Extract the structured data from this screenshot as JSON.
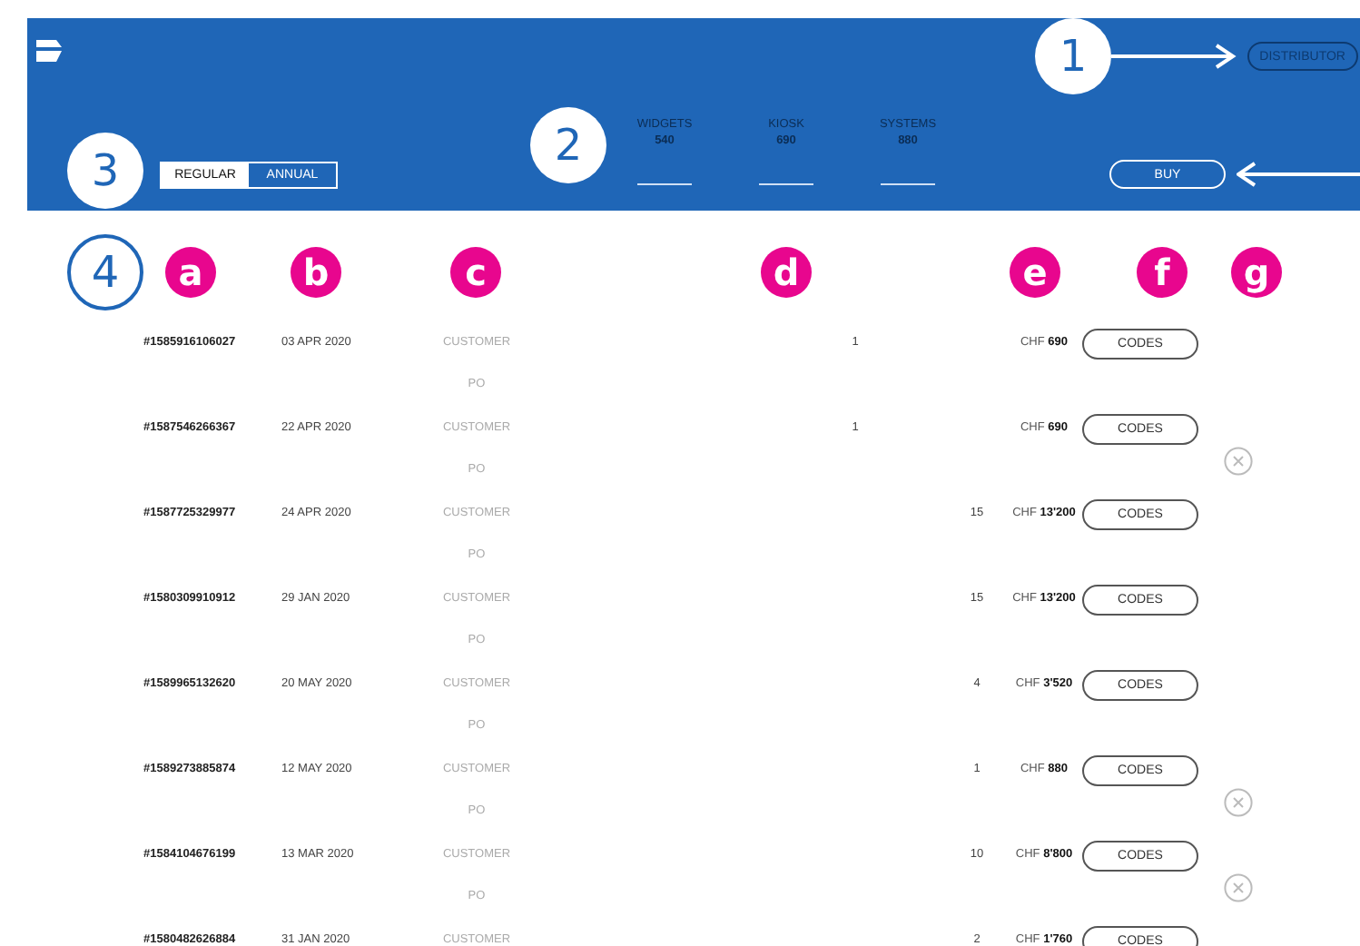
{
  "header": {
    "distributor_button": "DISTRIBUTOR",
    "plan_toggle": [
      {
        "label": "REGULAR",
        "selected": true
      },
      {
        "label": "ANNUAL",
        "selected": false
      }
    ],
    "products": [
      {
        "name": "WIDGETS",
        "price": "540"
      },
      {
        "name": "KIOSK",
        "price": "690"
      },
      {
        "name": "SYSTEMS",
        "price": "880"
      }
    ],
    "buy_button": "BUY"
  },
  "orders": [
    {
      "id": "#1585916106027",
      "date": "03 APR 2020",
      "reference": "CUSTOMER PO",
      "quantity": "1",
      "kind": "kiosk",
      "price": "CHF **690**",
      "action": "CODES",
      "removable": false
    },
    {
      "id": "#1587546266367",
      "date": "22 APR 2020",
      "reference": "CUSTOMER PO",
      "quantity": "1",
      "kind": "kiosk",
      "price": "CHF **690**",
      "action": "CODES",
      "removable": true
    },
    {
      "id": "#1587725329977",
      "date": "24 APR 2020",
      "reference": "CUSTOMER PO",
      "quantity": "15",
      "kind": "systems",
      "price": "CHF **13'200**",
      "action": "CODES",
      "removable": false
    },
    {
      "id": "#1580309910912",
      "date": "29 JAN 2020",
      "reference": "CUSTOMER PO",
      "quantity": "15",
      "kind": "systems",
      "price": "CHF **13'200**",
      "action": "CODES",
      "removable": false
    },
    {
      "id": "#1589965132620",
      "date": "20 MAY 2020",
      "reference": "CUSTOMER PO",
      "quantity": "4",
      "kind": "systems",
      "price": "CHF **3'520**",
      "action": "CODES",
      "removable": false
    },
    {
      "id": "#1589273885874",
      "date": "12 MAY 2020",
      "reference": "CUSTOMER PO",
      "quantity": "1",
      "kind": "systems",
      "price": "CHF **880**",
      "action": "CODES",
      "removable": true
    },
    {
      "id": "#1584104676199",
      "date": "13 MAR 2020",
      "reference": "CUSTOMER PO",
      "quantity": "10",
      "kind": "systems",
      "price": "CHF **8'800**",
      "action": "CODES",
      "removable": true
    },
    {
      "id": "#1580482626884",
      "date": "31 JAN 2020",
      "reference": "CUSTOMER",
      "quantity": "2",
      "kind": "systems",
      "price": "CHF **1'760**",
      "action": "CODES",
      "removable": false
    }
  ],
  "annotations": {
    "numbered": [
      {
        "label": "1",
        "kind": "filled"
      },
      {
        "label": "2",
        "kind": "filled"
      },
      {
        "label": "3",
        "kind": "filled"
      },
      {
        "label": "4",
        "kind": "outlined"
      }
    ],
    "lettered": [
      "a",
      "b",
      "c",
      "d",
      "e",
      "f",
      "g"
    ]
  }
}
